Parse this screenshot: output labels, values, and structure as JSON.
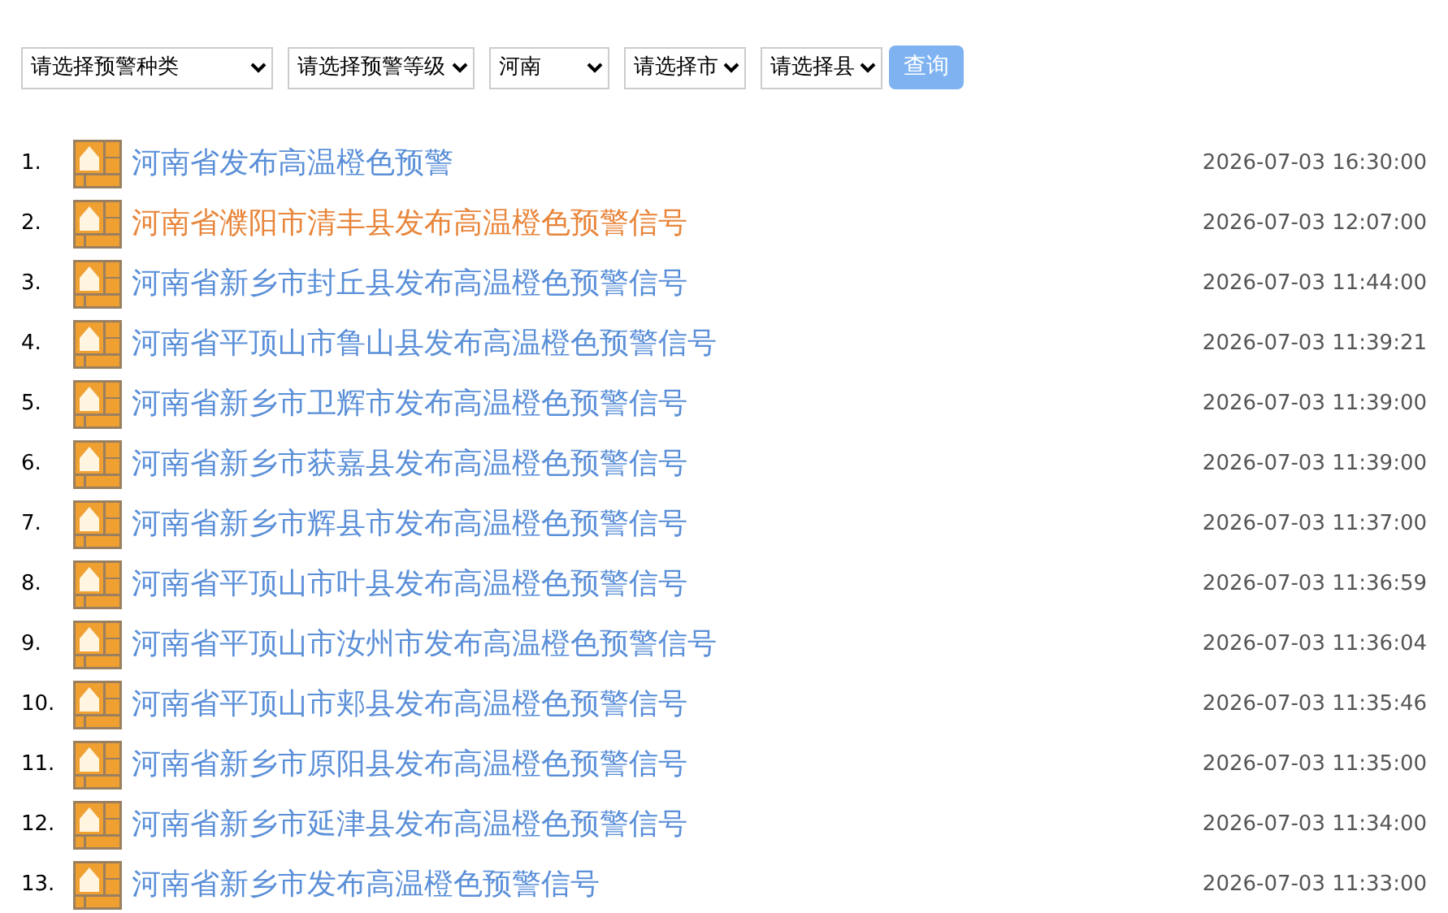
{
  "filters": [
    {
      "value": "请选择预警种类"
    },
    {
      "value": "请选择预警等级"
    },
    {
      "value": "河南"
    },
    {
      "value": "请选择市"
    },
    {
      "value": "请选择县"
    }
  ],
  "search_button": {
    "label": "查询"
  },
  "alerts": [
    {
      "index": "1.",
      "title": "河南省发布高温橙色预警",
      "time": "2026-07-03 16:30:00",
      "hovered": false
    },
    {
      "index": "2.",
      "title": "河南省濮阳市清丰县发布高温橙色预警信号",
      "time": "2026-07-03 12:07:00",
      "hovered": true
    },
    {
      "index": "3.",
      "title": "河南省新乡市封丘县发布高温橙色预警信号",
      "time": "2026-07-03 11:44:00",
      "hovered": false
    },
    {
      "index": "4.",
      "title": "河南省平顶山市鲁山县发布高温橙色预警信号",
      "time": "2026-07-03 11:39:21",
      "hovered": false
    },
    {
      "index": "5.",
      "title": "河南省新乡市卫辉市发布高温橙色预警信号",
      "time": "2026-07-03 11:39:00",
      "hovered": false
    },
    {
      "index": "6.",
      "title": "河南省新乡市获嘉县发布高温橙色预警信号",
      "time": "2026-07-03 11:39:00",
      "hovered": false
    },
    {
      "index": "7.",
      "title": "河南省新乡市辉县市发布高温橙色预警信号",
      "time": "2026-07-03 11:37:00",
      "hovered": false
    },
    {
      "index": "8.",
      "title": "河南省平顶山市叶县发布高温橙色预警信号",
      "time": "2026-07-03 11:36:59",
      "hovered": false
    },
    {
      "index": "9.",
      "title": "河南省平顶山市汝州市发布高温橙色预警信号",
      "time": "2026-07-03 11:36:04",
      "hovered": false
    },
    {
      "index": "10.",
      "title": "河南省平顶山市郏县发布高温橙色预警信号",
      "time": "2026-07-03 11:35:46",
      "hovered": false
    },
    {
      "index": "11.",
      "title": "河南省新乡市原阳县发布高温橙色预警信号",
      "time": "2026-07-03 11:35:00",
      "hovered": false
    },
    {
      "index": "12.",
      "title": "河南省新乡市延津县发布高温橙色预警信号",
      "time": "2026-07-03 11:34:00",
      "hovered": false
    },
    {
      "index": "13.",
      "title": "河南省新乡市发布高温橙色预警信号",
      "time": "2026-07-03 11:33:00",
      "hovered": false
    }
  ]
}
